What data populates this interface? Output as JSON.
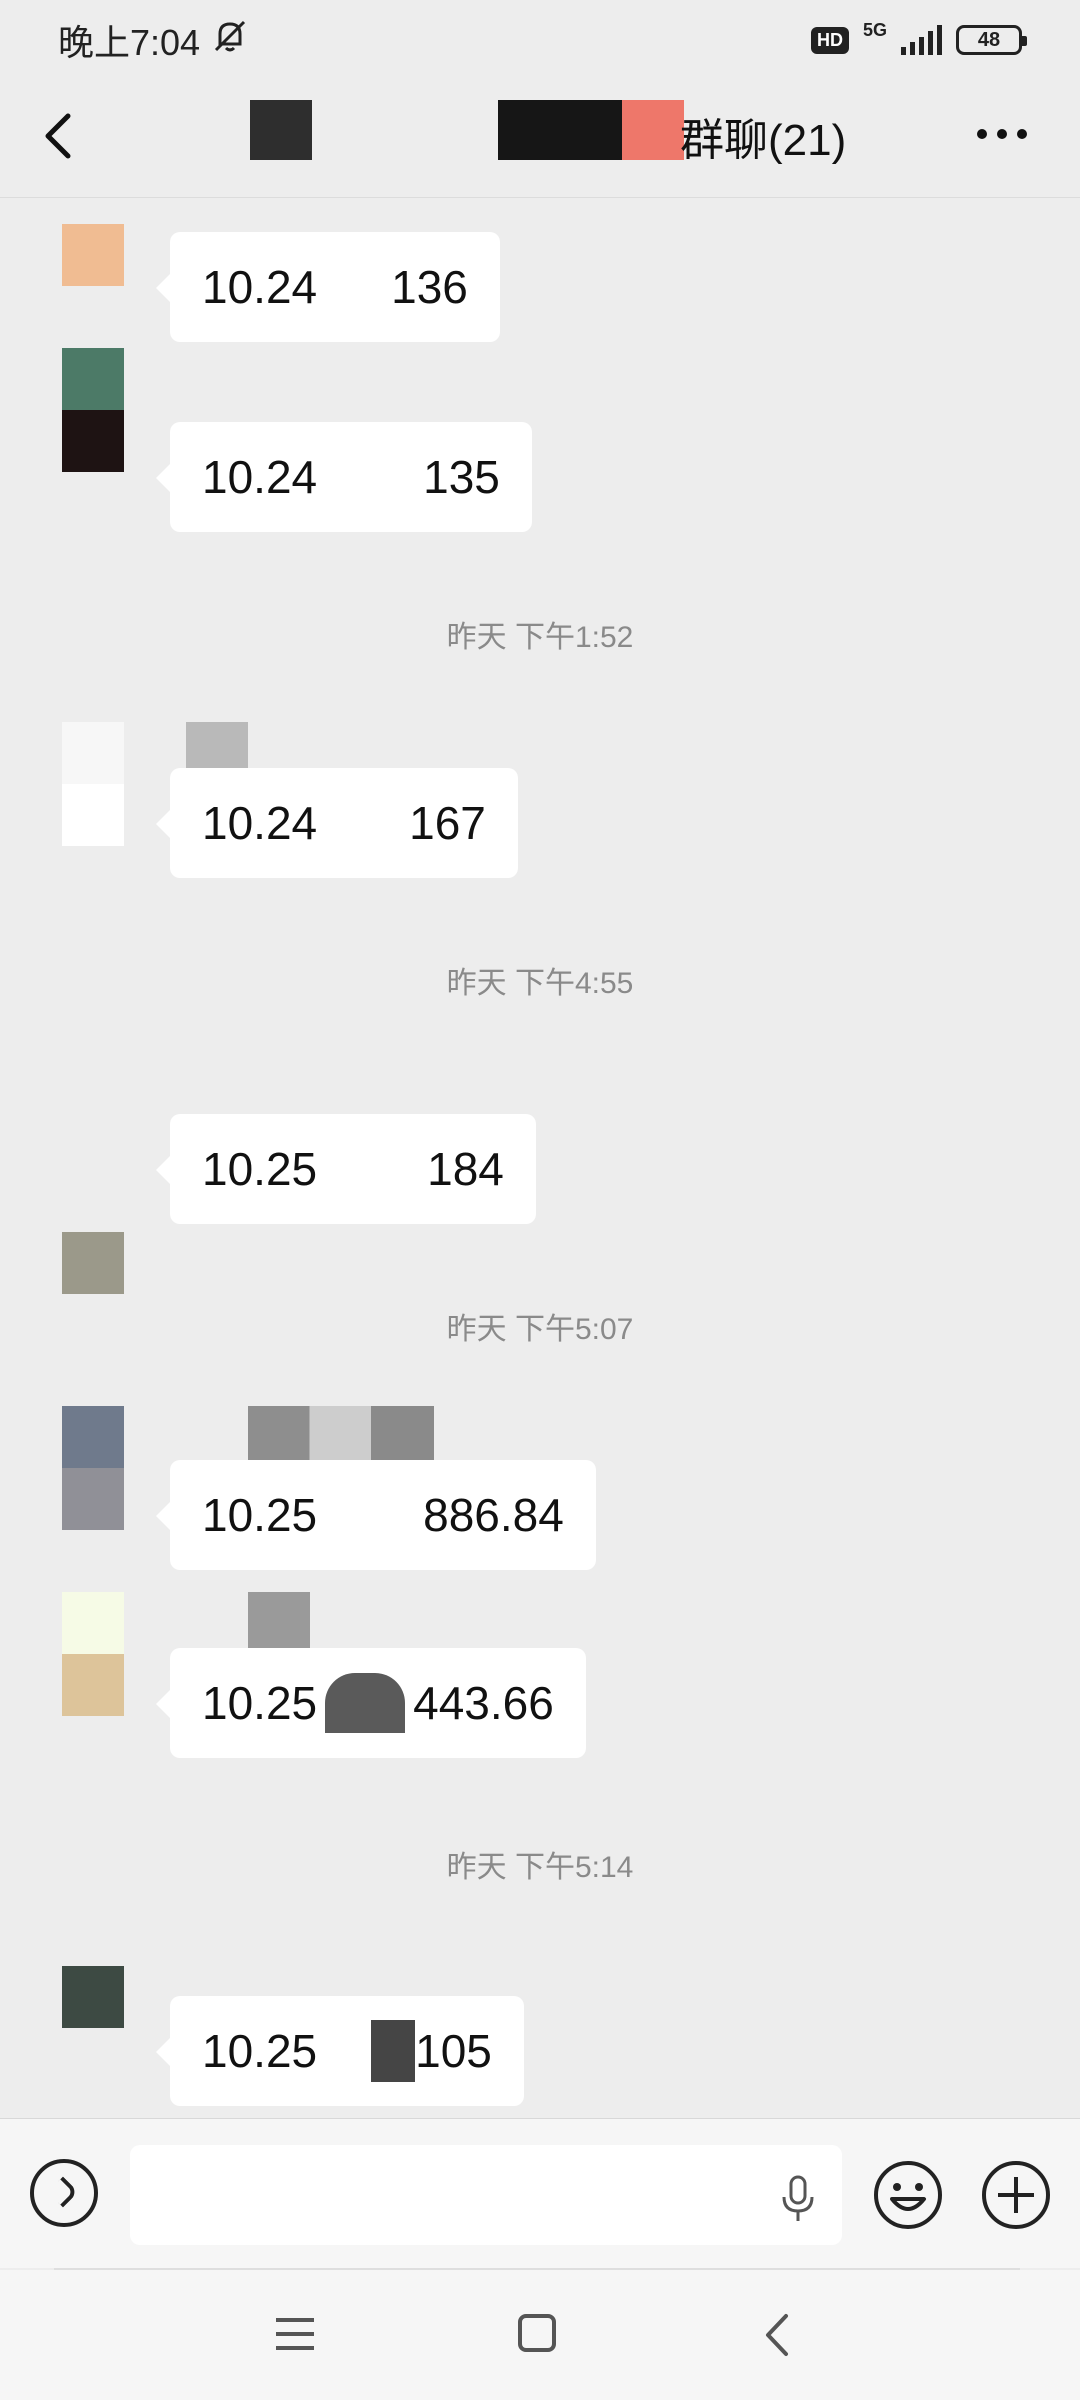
{
  "status_bar": {
    "time": "晚上7:04",
    "mute_icon": "bell-muted-icon",
    "hd": "HD",
    "network": "5G",
    "battery": "48"
  },
  "header": {
    "title": "群聊(21)",
    "back_icon": "chevron-left-icon",
    "more_icon": "more-dots-icon"
  },
  "messages": [
    {
      "date": "10.24",
      "amount": "136",
      "avatar_colors": [
        "#f0bc92"
      ]
    },
    {
      "date": "10.24",
      "amount": "135",
      "avatar_colors": [
        "#4c7a67",
        "#1e1313"
      ]
    },
    {
      "date": "10.24",
      "amount": "167",
      "avatar_colors": [
        "#f7f7f7",
        "#ffffff"
      ]
    },
    {
      "date": "10.25",
      "amount": "184",
      "avatar_colors": [
        "#e6e9e7",
        "#9b998a"
      ]
    },
    {
      "date": "10.25",
      "amount": "886.84",
      "avatar_colors": [
        "#6f7a8c",
        "#909097"
      ]
    },
    {
      "date": "10.25",
      "amount": "443.66",
      "avatar_colors": [
        "#f6fbe6",
        "#ddc49a"
      ]
    },
    {
      "date": "10.25",
      "amount": "105",
      "avatar_colors": [
        "#3d4a43"
      ]
    }
  ],
  "timestamps": [
    "昨天 下午1:52",
    "昨天 下午4:55",
    "昨天 下午5:07",
    "昨天 下午5:14"
  ],
  "input_bar": {
    "voice_icon": "voice-toggle-icon",
    "mic_icon": "microphone-icon",
    "emoji_icon": "emoji-icon",
    "plus_icon": "plus-icon"
  },
  "nav_bar": {
    "menu_icon": "menu-icon",
    "home_icon": "home-square-icon",
    "back_icon": "back-chevron-icon"
  }
}
